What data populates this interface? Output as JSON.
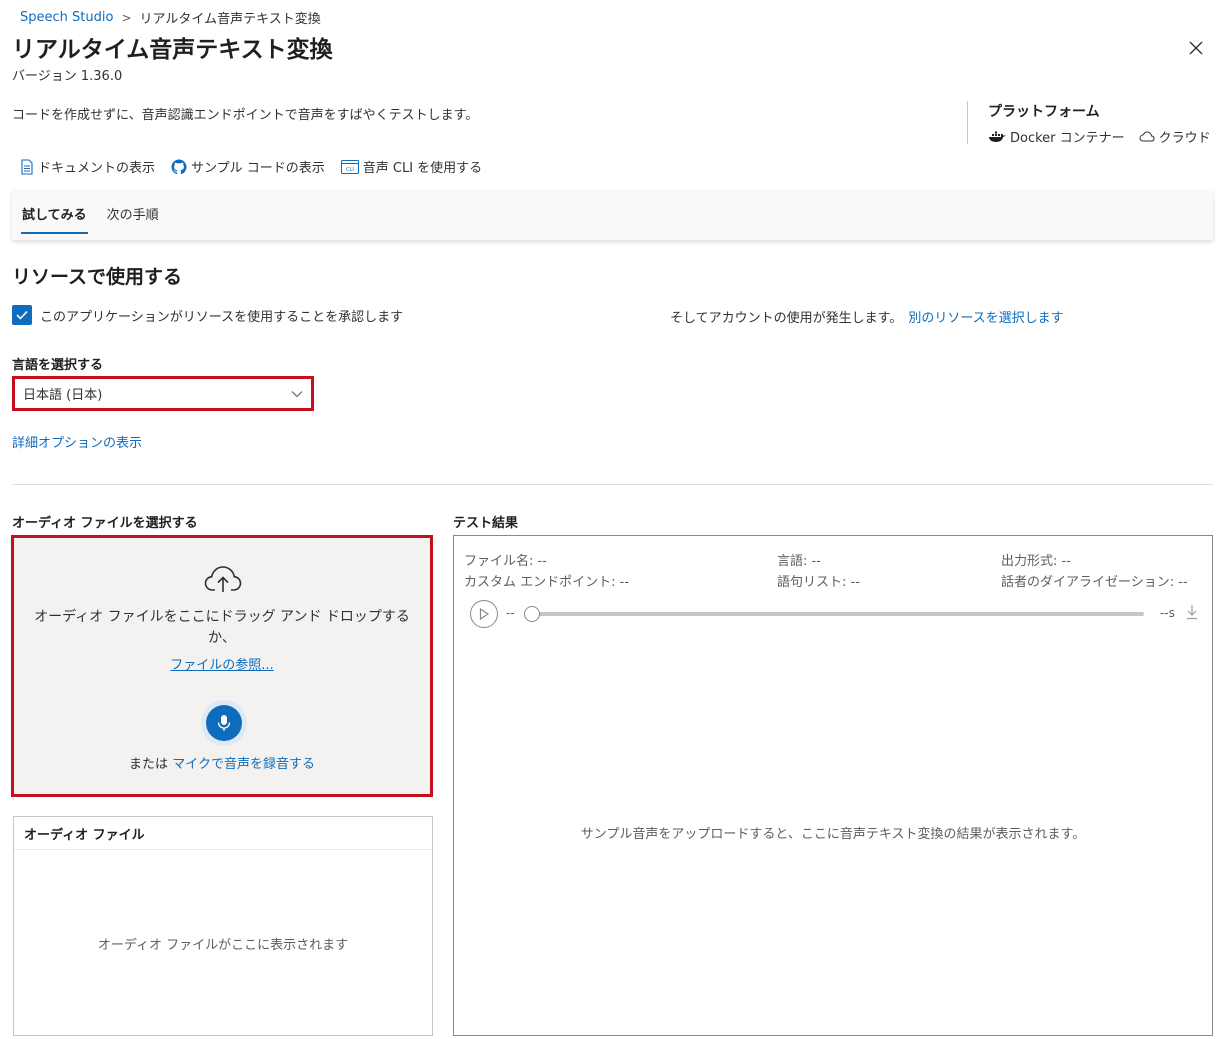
{
  "breadcrumb": {
    "root": "Speech Studio",
    "separator": ">",
    "current": "リアルタイム音声テキスト変換"
  },
  "header": {
    "title": "リアルタイム音声テキスト変換",
    "version": "バージョン 1.36.0",
    "description": "コードを作成せずに、音声認識エンドポイントで音声をすばやくテストします。"
  },
  "platform": {
    "title": "プラットフォーム",
    "items": [
      {
        "label": "Docker コンテナー",
        "icon": "docker-icon"
      },
      {
        "label": "クラウド",
        "icon": "cloud-icon"
      }
    ]
  },
  "links": [
    {
      "label": "ドキュメントの表示",
      "icon": "document-icon"
    },
    {
      "label": "サンプル コードの表示",
      "icon": "github-icon"
    },
    {
      "label": "音声 CLI を使用する",
      "icon": "cli-icon"
    }
  ],
  "tabs": [
    {
      "label": "試してみる",
      "active": true
    },
    {
      "label": "次の手順",
      "active": false
    }
  ],
  "resource": {
    "title": "リソースで使用する",
    "consent_label": "このアプリケーションがリソースを使用することを承認します",
    "consent_checked": true,
    "account_text": "そしてアカウントの使用が発生します。",
    "select_other": "別のリソースを選択します"
  },
  "language": {
    "label": "言語を選択する",
    "value": "日本語 (日本)",
    "advanced_link": "詳細オプションの表示"
  },
  "upload": {
    "label": "オーディオ ファイルを選択する",
    "drop_text": "オーディオ ファイルをここにドラッグ アンド ドロップするか、",
    "browse": "ファイルの参照...",
    "or_text": "または",
    "record": "マイクで音声を録音する"
  },
  "audio_files": {
    "title": "オーディオ ファイル",
    "empty": "オーディオ ファイルがここに表示されます"
  },
  "results": {
    "label": "テスト結果",
    "file_name": "ファイル名: --",
    "language": "言語: --",
    "output_format": "出力形式: --",
    "custom_endpoint": "カスタム エンドポイント: --",
    "phrase_list": "語句リスト: --",
    "diarization": "話者のダイアライゼーション: --",
    "elapsed": "--",
    "duration": "--s",
    "empty": "サンプル音声をアップロードすると、ここに音声テキスト変換の結果が表示されます。"
  },
  "colors": {
    "accent": "#0f6cbd",
    "highlight_border": "#c50f1f",
    "dropzone_bg": "#f3f2f1"
  }
}
